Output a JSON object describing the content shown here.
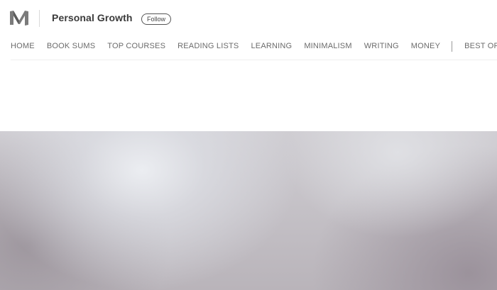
{
  "header": {
    "logo_icon": "medium-logo-icon",
    "publication_title": "Personal Growth",
    "follow_label": "Follow"
  },
  "nav": {
    "items": [
      {
        "label": "HOME"
      },
      {
        "label": "BOOK SUMS"
      },
      {
        "label": "TOP COURSES"
      },
      {
        "label": "READING LISTS"
      },
      {
        "label": "LEARNING"
      },
      {
        "label": "MINIMALISM"
      },
      {
        "label": "WRITING"
      },
      {
        "label": "MONEY"
      },
      {
        "label": "BEST OF PG"
      }
    ]
  },
  "colors": {
    "text_dark": "#3b3b3b",
    "nav_text": "#6b6b6b",
    "hero_light": "#eceef2",
    "hero_dark": "#968e96"
  }
}
